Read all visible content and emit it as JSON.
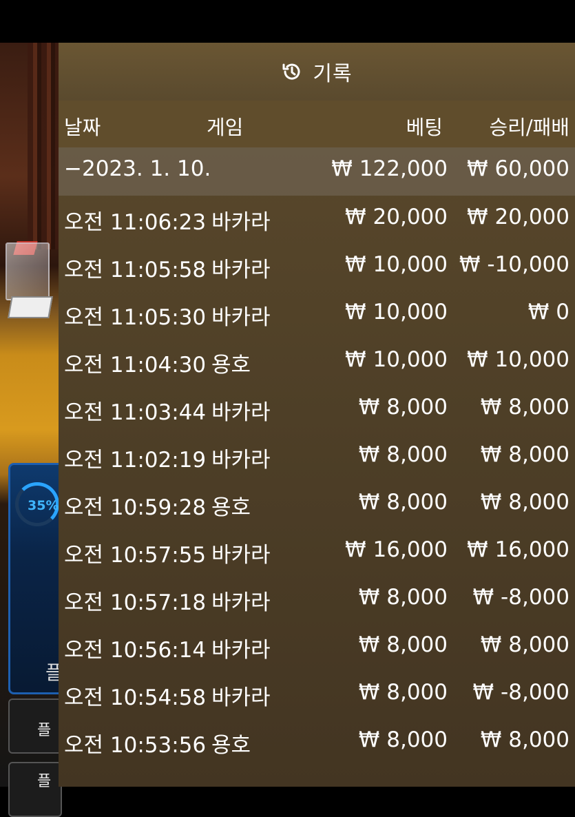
{
  "background": {
    "progress_label": "35%",
    "panel_char": "플",
    "side_buttons": [
      "플",
      "플"
    ]
  },
  "history": {
    "title": "기록",
    "title_icon": "history-icon",
    "columns": {
      "date": "날짜",
      "game": "게임",
      "bet": "베팅",
      "result": "승리/패배"
    },
    "date_group": {
      "label": "−2023. 1. 10.",
      "bet_total": "₩ 122,000",
      "result_total": "₩ 60,000"
    },
    "rows": [
      {
        "time": "오전 11:06:23",
        "game": "바카라",
        "bet": "₩ 20,000",
        "result": "₩ 20,000"
      },
      {
        "time": "오전 11:05:58",
        "game": "바카라",
        "bet": "₩ 10,000",
        "result": "₩ -10,000"
      },
      {
        "time": "오전 11:05:30",
        "game": "바카라",
        "bet": "₩ 10,000",
        "result": "₩ 0"
      },
      {
        "time": "오전 11:04:30",
        "game": "용호",
        "bet": "₩ 10,000",
        "result": "₩ 10,000"
      },
      {
        "time": "오전 11:03:44",
        "game": "바카라",
        "bet": "₩ 8,000",
        "result": "₩ 8,000"
      },
      {
        "time": "오전 11:02:19",
        "game": "바카라",
        "bet": "₩ 8,000",
        "result": "₩ 8,000"
      },
      {
        "time": "오전 10:59:28",
        "game": "용호",
        "bet": "₩ 8,000",
        "result": "₩ 8,000"
      },
      {
        "time": "오전 10:57:55",
        "game": "바카라",
        "bet": "₩ 16,000",
        "result": "₩ 16,000"
      },
      {
        "time": "오전 10:57:18",
        "game": "바카라",
        "bet": "₩ 8,000",
        "result": "₩ -8,000"
      },
      {
        "time": "오전 10:56:14",
        "game": "바카라",
        "bet": "₩ 8,000",
        "result": "₩ 8,000"
      },
      {
        "time": "오전 10:54:58",
        "game": "바카라",
        "bet": "₩ 8,000",
        "result": "₩ -8,000"
      },
      {
        "time": "오전 10:53:56",
        "game": "용호",
        "bet": "₩ 8,000",
        "result": "₩ 8,000"
      }
    ]
  }
}
